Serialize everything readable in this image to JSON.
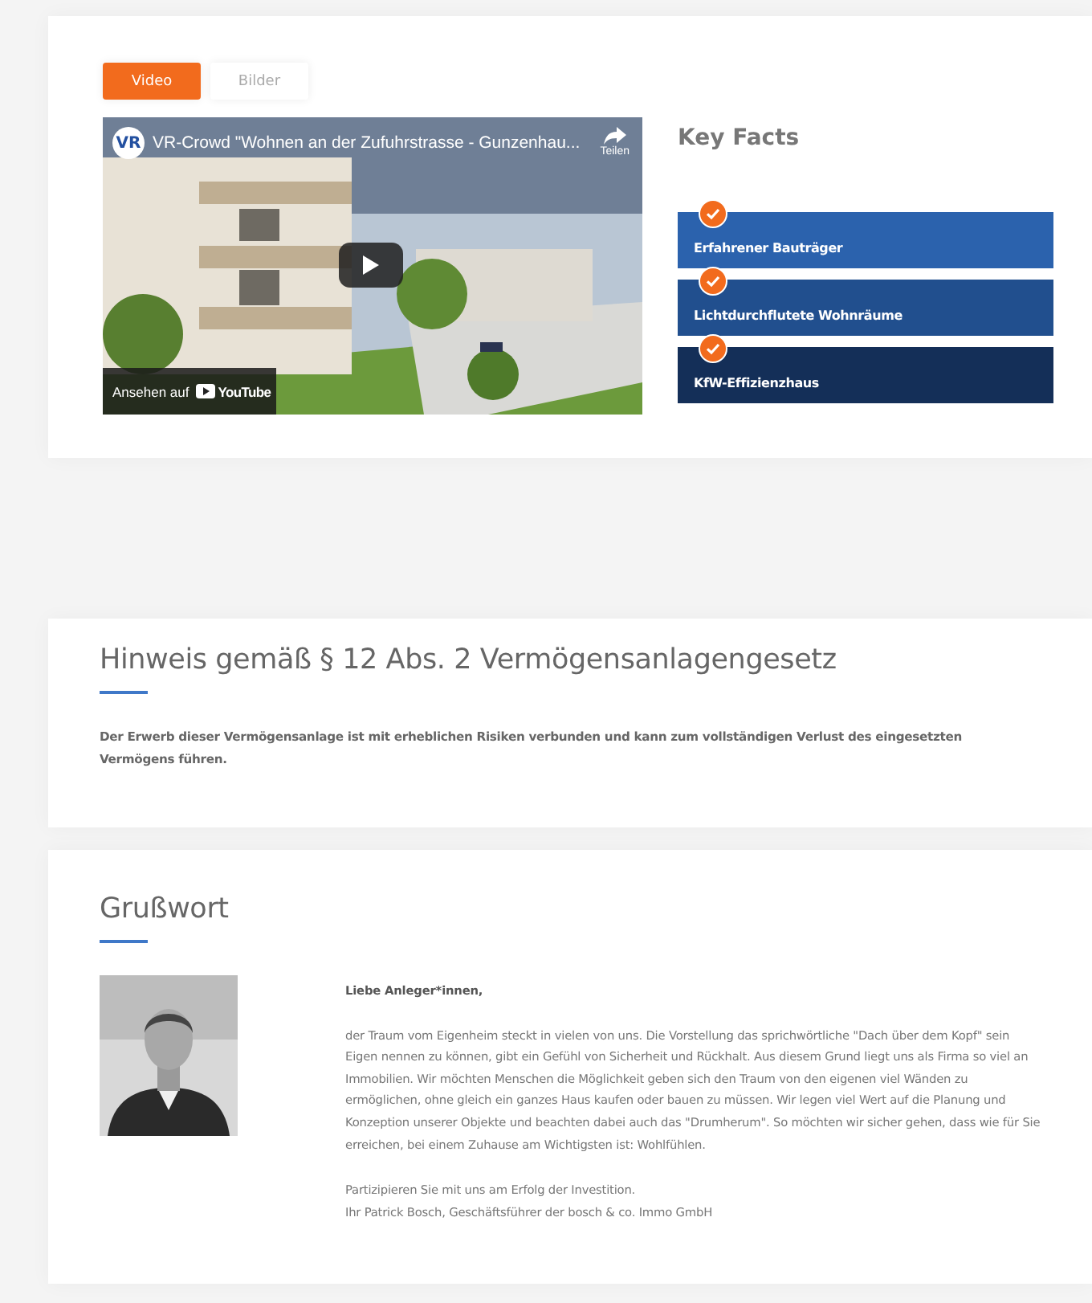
{
  "tabs": [
    {
      "label": "Video",
      "selected": true
    },
    {
      "label": "Bilder",
      "selected": false
    }
  ],
  "video": {
    "channel_logo": "VR",
    "title": "VR-Crowd \"Wohnen an der Zufuhrstrasse - Gunzenhau...",
    "share_label": "Teilen",
    "watch_on": "Ansehen auf",
    "platform": "YouTube"
  },
  "key_facts": {
    "title": "Key Facts",
    "items": [
      {
        "label": "Erfahrener Bauträger",
        "color": "#2b62ad"
      },
      {
        "label": "Lichtdurchflutete Wohnräume",
        "color": "#214f8e"
      },
      {
        "label": "KfW-Effizienzhaus",
        "color": "#142f58"
      }
    ]
  },
  "notice": {
    "heading": "Hinweis gemäß § 12 Abs. 2 Vermögensanlagengesetz",
    "text": "Der Erwerb dieser Vermögensanlage ist mit erheblichen Risiken verbunden und kann zum vollständigen Verlust des eingesetzten Vermögens führen."
  },
  "greeting": {
    "heading": "Grußwort",
    "salutation": "Liebe Anleger*innen,",
    "body": "der Traum vom Eigenheim steckt in vielen von uns. Die Vorstellung das sprichwörtliche \"Dach über dem Kopf\" sein Eigen nennen zu können, gibt ein Gefühl von Sicherheit und Rückhalt. Aus diesem Grund liegt uns als Firma so viel an Immobilien. Wir möchten Menschen die Möglichkeit geben sich den Traum von den eigenen viel Wänden zu ermöglichen, ohne gleich ein ganzes Haus kaufen oder bauen zu müssen. Wir legen viel Wert auf die Planung und Konzeption unserer Objekte und beachten dabei auch das \"Drumherum\". So möchten wir sicher gehen, dass wie für Sie erreichen, bei einem Zuhause am Wichtigsten ist: Wohlfühlen.",
    "closing": [
      "Partizipieren Sie mit uns am Erfolg der Investition.",
      "Ihr Patrick Bosch, Geschäftsführer der bosch & co. Immo GmbH"
    ]
  }
}
